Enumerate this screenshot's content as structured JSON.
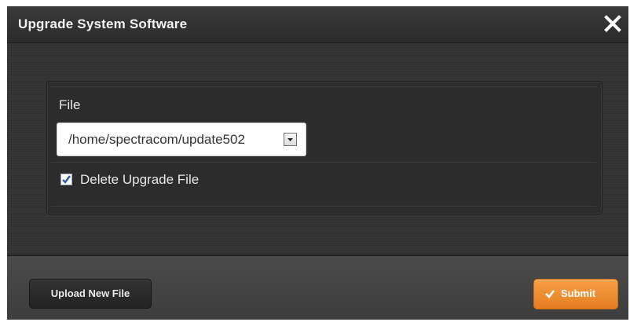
{
  "dialog": {
    "title": "Upgrade System Software",
    "close_icon": "close-icon"
  },
  "form": {
    "file_label": "File",
    "file_value": "/home/spectracom/update502",
    "delete_upgrade_file": {
      "label": "Delete Upgrade File",
      "checked": true
    }
  },
  "footer": {
    "upload_label": "Upload New File",
    "submit_label": "Submit",
    "submit_icon": "checkmark-icon"
  },
  "colors": {
    "submit_accent": "#f28c28",
    "checkbox_check": "#2f5fa8"
  }
}
